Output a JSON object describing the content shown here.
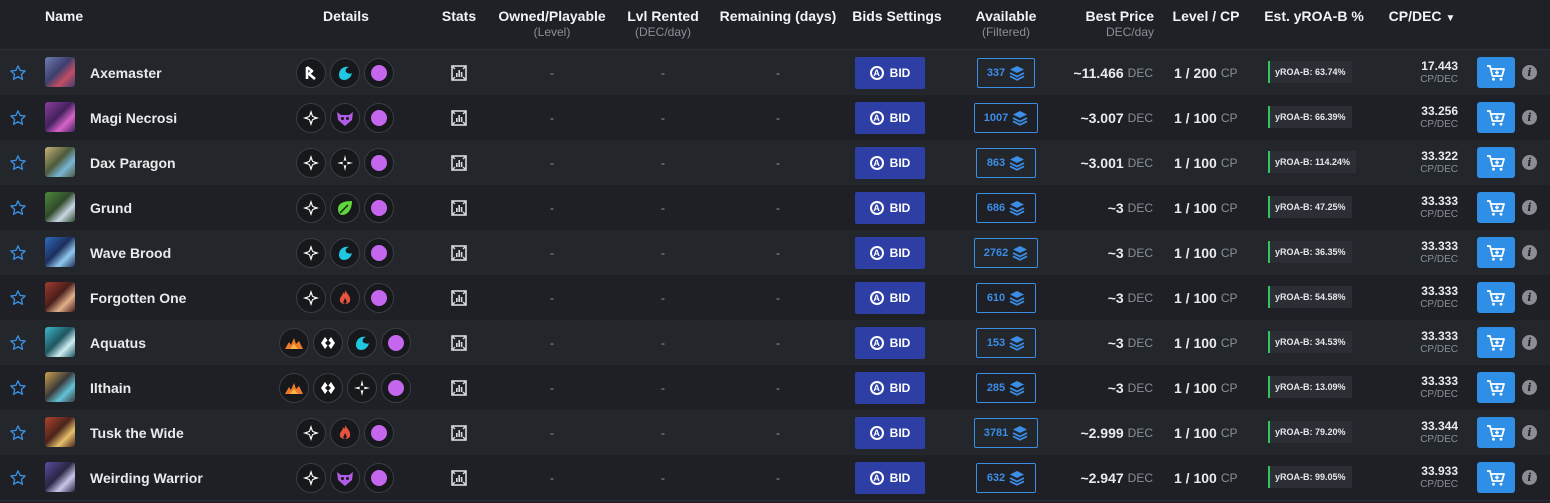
{
  "header": {
    "name": "Name",
    "details": "Details",
    "stats": "Stats",
    "owned": "Owned/Playable",
    "owned_sub": "(Level)",
    "rented": "Lvl Rented",
    "rented_sub": "(DEC/day)",
    "remaining": "Remaining (days)",
    "bids": "Bids Settings",
    "available": "Available",
    "available_sub": "(Filtered)",
    "best_price": "Best Price",
    "best_price_sub": "DEC/day",
    "level_cp": "Level / CP",
    "yroa": "Est. yROA-B %",
    "cpdec": "CP/DEC"
  },
  "labels": {
    "dash": "-",
    "bid": "BID",
    "dec": "DEC",
    "cp": "CP",
    "cpdec_unit": "CP/DEC",
    "info": "i",
    "bid_circle": "A"
  },
  "colors": {
    "accent_blue": "#2f8fe6",
    "bid_blue": "#2d3fa4",
    "yroa_green": "#34c45a"
  },
  "rows": [
    {
      "name": "Axemaster",
      "icons": [
        "rarity-r-icon",
        "water-icon",
        "purple-orb-icon"
      ],
      "available": "337",
      "price": "~11.466",
      "level": "1 / 200",
      "yroa": "yROA-B: 63.74%",
      "cpdec": "17.443"
    },
    {
      "name": "Magi Necrosi",
      "icons": [
        "neutral-icon",
        "death-icon",
        "purple-orb-icon"
      ],
      "available": "1007",
      "price": "~3.007",
      "level": "1 / 100",
      "yroa": "yROA-B: 66.39%",
      "cpdec": "33.256"
    },
    {
      "name": "Dax Paragon",
      "icons": [
        "neutral-icon",
        "life-icon",
        "purple-orb-icon"
      ],
      "available": "863",
      "price": "~3.001",
      "level": "1 / 100",
      "yroa": "yROA-B: 114.24%",
      "cpdec": "33.322"
    },
    {
      "name": "Grund",
      "icons": [
        "neutral-icon",
        "earth-icon",
        "purple-orb-icon"
      ],
      "available": "686",
      "price": "~3",
      "level": "1 / 100",
      "yroa": "yROA-B: 47.25%",
      "cpdec": "33.333"
    },
    {
      "name": "Wave Brood",
      "icons": [
        "neutral-icon",
        "water-icon",
        "purple-orb-icon"
      ],
      "available": "2762",
      "price": "~3",
      "level": "1 / 100",
      "yroa": "yROA-B: 36.35%",
      "cpdec": "33.333"
    },
    {
      "name": "Forgotten One",
      "icons": [
        "neutral-icon",
        "fire-icon",
        "purple-orb-icon"
      ],
      "available": "610",
      "price": "~3",
      "level": "1 / 100",
      "yroa": "yROA-B: 54.58%",
      "cpdec": "33.333"
    },
    {
      "name": "Aquatus",
      "icons": [
        "burst-icon",
        "gem-icon",
        "water-icon",
        "purple-orb-icon"
      ],
      "available": "153",
      "price": "~3",
      "level": "1 / 100",
      "yroa": "yROA-B: 34.53%",
      "cpdec": "33.333"
    },
    {
      "name": "Ilthain",
      "icons": [
        "burst-icon",
        "gem-icon",
        "life-icon",
        "purple-orb-icon"
      ],
      "available": "285",
      "price": "~3",
      "level": "1 / 100",
      "yroa": "yROA-B: 13.09%",
      "cpdec": "33.333"
    },
    {
      "name": "Tusk the Wide",
      "icons": [
        "neutral-icon",
        "fire-icon",
        "purple-orb-icon"
      ],
      "available": "3781",
      "price": "~2.999",
      "level": "1 / 100",
      "yroa": "yROA-B: 79.20%",
      "cpdec": "33.344"
    },
    {
      "name": "Weirding Warrior",
      "icons": [
        "neutral-icon",
        "death-icon",
        "purple-orb-icon"
      ],
      "available": "632",
      "price": "~2.947",
      "level": "1 / 100",
      "yroa": "yROA-B: 99.05%",
      "cpdec": "33.933"
    }
  ]
}
